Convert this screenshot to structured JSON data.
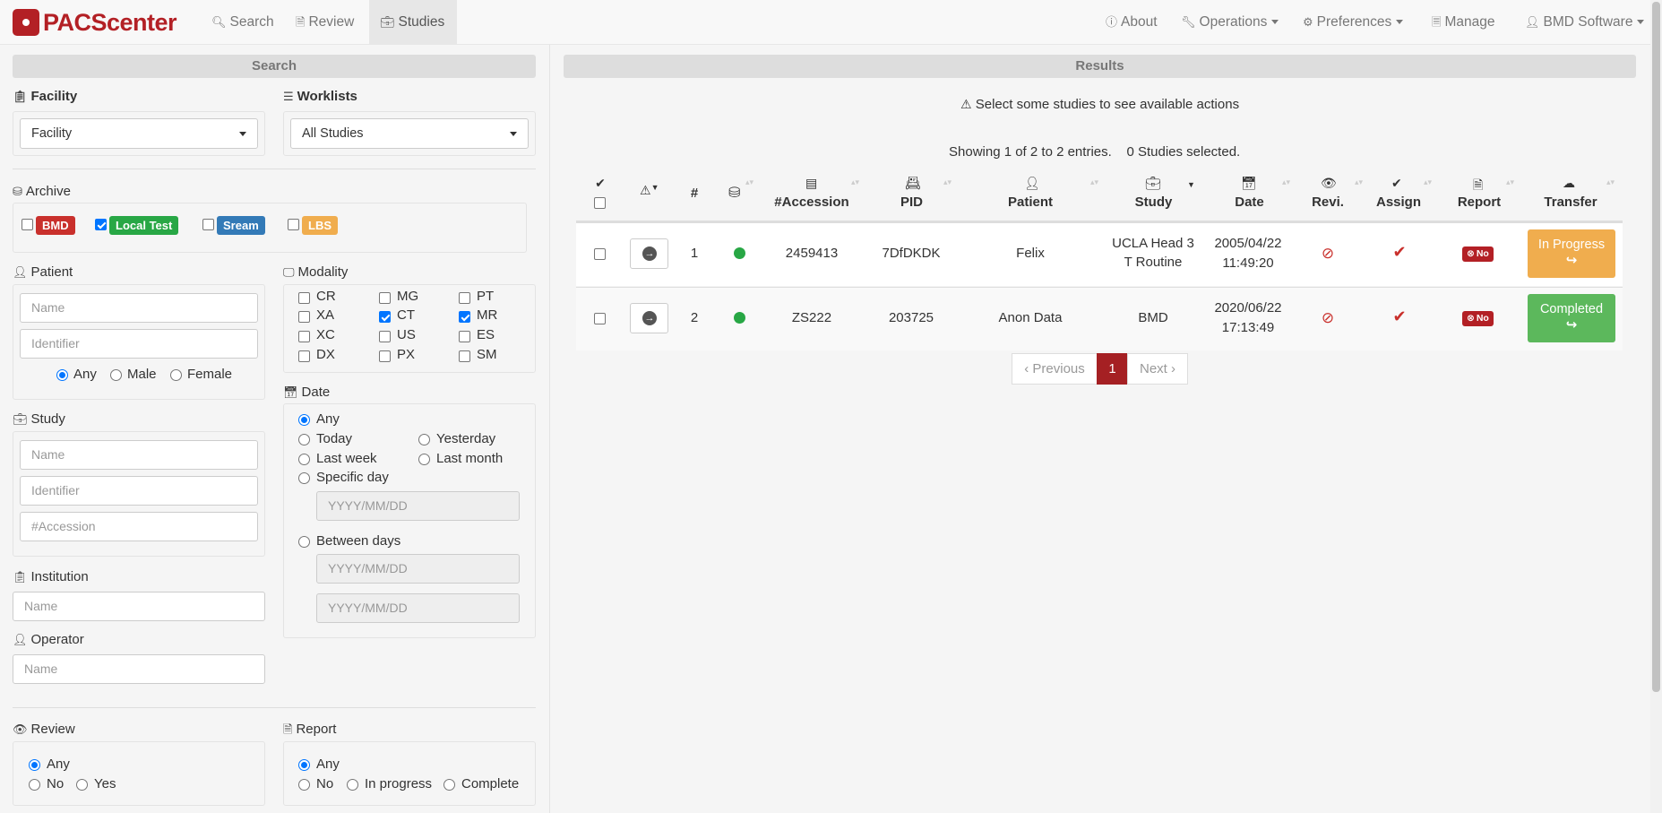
{
  "app": {
    "brand": "PACScenter"
  },
  "nav": {
    "search": "Search",
    "review": "Review",
    "studies": "Studies",
    "about": "About",
    "operations": "Operations",
    "preferences": "Preferences",
    "manage": "Manage",
    "user": "BMD Software"
  },
  "search_panel": {
    "title": "Search",
    "facility": {
      "label": "Facility",
      "value": "Facility"
    },
    "worklists": {
      "label": "Worklists",
      "value": "All Studies"
    },
    "archive": {
      "label": "Archive",
      "items": [
        {
          "name": "BMD",
          "checked": false,
          "color": "#c9302c"
        },
        {
          "name": "Local Test",
          "checked": true,
          "color": "#28a745"
        },
        {
          "name": "Sream",
          "checked": false,
          "color": "#337ab7"
        },
        {
          "name": "LBS",
          "checked": false,
          "color": "#f0ad4e"
        }
      ]
    },
    "patient": {
      "label": "Patient",
      "name_placeholder": "Name",
      "identifier_placeholder": "Identifier",
      "sex_options": [
        "Any",
        "Male",
        "Female"
      ],
      "sex_selected": "Any"
    },
    "modality": {
      "label": "Modality",
      "items": [
        {
          "name": "CR",
          "checked": false
        },
        {
          "name": "MG",
          "checked": false
        },
        {
          "name": "PT",
          "checked": false
        },
        {
          "name": "XA",
          "checked": false
        },
        {
          "name": "CT",
          "checked": true
        },
        {
          "name": "MR",
          "checked": true
        },
        {
          "name": "XC",
          "checked": false
        },
        {
          "name": "US",
          "checked": false
        },
        {
          "name": "ES",
          "checked": false
        },
        {
          "name": "DX",
          "checked": false
        },
        {
          "name": "PX",
          "checked": false
        },
        {
          "name": "SM",
          "checked": false
        }
      ]
    },
    "study": {
      "label": "Study",
      "name_placeholder": "Name",
      "identifier_placeholder": "Identifier",
      "accession_placeholder": "#Accession"
    },
    "date": {
      "label": "Date",
      "options": [
        "Any",
        "Today",
        "Yesterday",
        "Last week",
        "Last month",
        "Specific day",
        "Between days"
      ],
      "selected": "Any",
      "date_placeholder": "YYYY/MM/DD"
    },
    "institution": {
      "label": "Institution",
      "placeholder": "Name"
    },
    "operator": {
      "label": "Operator",
      "placeholder": "Name"
    },
    "review": {
      "label": "Review",
      "options": [
        "Any",
        "No",
        "Yes"
      ],
      "selected": "Any"
    },
    "report": {
      "label": "Report",
      "options": [
        "Any",
        "No",
        "In progress",
        "Complete"
      ],
      "selected": "Any"
    }
  },
  "results_panel": {
    "title": "Results",
    "notice": "Select some studies to see available actions",
    "showing": "Showing 1 of 2 to 2 entries.",
    "selected": "0 Studies selected.",
    "columns": {
      "num": "#",
      "accession": "#Accession",
      "pid": "PID",
      "patient": "Patient",
      "study": "Study",
      "date": "Date",
      "review": "Revi.",
      "assign": "Assign",
      "report": "Report",
      "transfer": "Transfer"
    },
    "rows": [
      {
        "num": "1",
        "accession": "2459413",
        "pid": "7DfDKDK",
        "patient": "Felix",
        "study": "UCLA Head 3 T Routine",
        "date": "2005/04/22",
        "time": "11:49:20",
        "report": "No",
        "transfer": "In Progress",
        "transfer_color": "#f0ad4e"
      },
      {
        "num": "2",
        "accession": "ZS222",
        "pid": "203725",
        "patient": "Anon Data",
        "study": "BMD",
        "date": "2020/06/22",
        "time": "17:13:49",
        "report": "No",
        "transfer": "Completed",
        "transfer_color": "#5cb85c"
      }
    ],
    "pagination": {
      "previous": "Previous",
      "current": "1",
      "next": "Next"
    }
  }
}
